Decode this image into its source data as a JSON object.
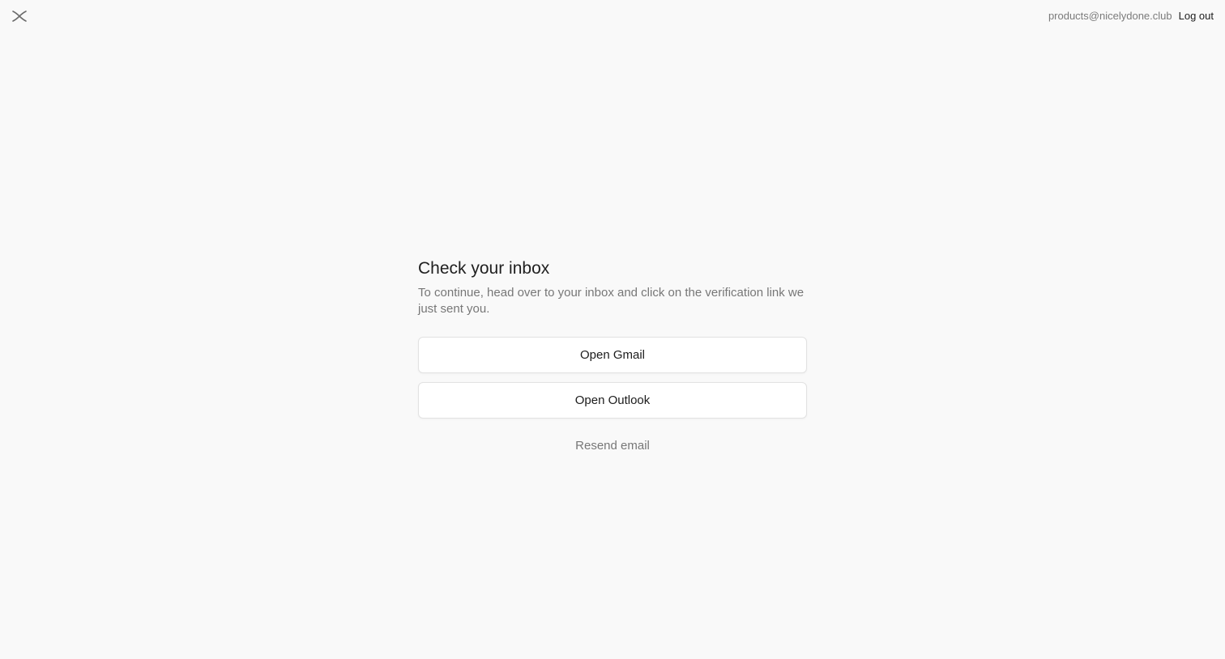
{
  "header": {
    "logo_icon": "x-logo-icon",
    "account_email": "products@nicelydone.club",
    "logout_label": "Log out"
  },
  "main": {
    "title": "Check your inbox",
    "subtitle": "To continue, head over to your inbox and click on the verification link we just sent you.",
    "open_gmail_label": "Open Gmail",
    "open_outlook_label": "Open Outlook",
    "resend_label": "Resend email"
  },
  "colors": {
    "background": "#f9f9f9",
    "text_primary": "#1c1c1c",
    "text_secondary": "#777777",
    "button_bg": "#ffffff",
    "button_border": "#e2e2e2"
  }
}
